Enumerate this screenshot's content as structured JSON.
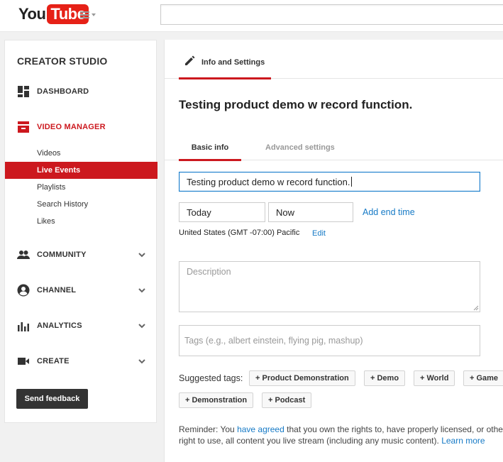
{
  "header": {
    "logo_you": "You",
    "logo_tube": "Tube"
  },
  "sidebar": {
    "title": "CREATOR STUDIO",
    "dashboard": "DASHBOARD",
    "video_manager": "VIDEO MANAGER",
    "sub_items": [
      "Videos",
      "Live Events",
      "Playlists",
      "Search History",
      "Likes"
    ],
    "active_sub": "Live Events",
    "community": "COMMUNITY",
    "channel": "CHANNEL",
    "analytics": "ANALYTICS",
    "create": "CREATE",
    "feedback_button": "Send feedback"
  },
  "main": {
    "top_tab": "Info and Settings",
    "video_title": "Testing product demo w record function.",
    "subtabs": {
      "basic": "Basic info",
      "advanced": "Advanced settings"
    },
    "title_input_value": "Testing product demo w record function.",
    "date_value": "Today",
    "time_value": "Now",
    "add_end_time": "Add end time",
    "timezone": "United States (GMT -07:00) Pacific",
    "edit_link": "Edit",
    "description_placeholder": "Description",
    "tags_placeholder": "Tags (e.g., albert einstein, flying pig, mashup)",
    "suggested_label": "Suggested tags:",
    "suggested_tags": [
      "+ Product Demonstration",
      "+ Demo",
      "+ World",
      "+ Game",
      "+ Demonstration",
      "+ Podcast"
    ],
    "reminder": {
      "prefix": "Reminder: You ",
      "link1": "have agreed",
      "middle": " that you own the rights to, have properly licensed, or othe",
      "line2": "right to use, all content you live stream (including any music content). ",
      "link2": "Learn more"
    }
  },
  "colors": {
    "accent_red": "#cc181e",
    "link_blue": "#167ac6",
    "focus_blue": "#1b7fcc"
  }
}
